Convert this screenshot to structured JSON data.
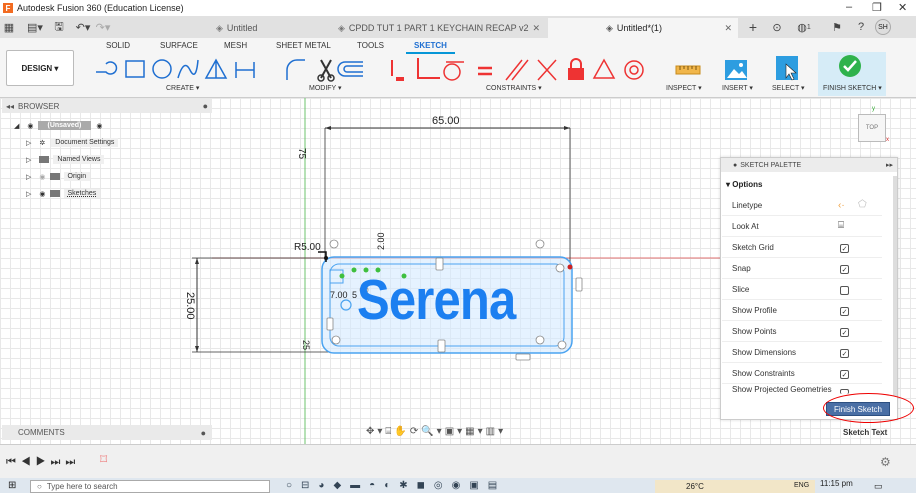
{
  "window": {
    "title": "Autodesk Fusion 360 (Education License)"
  },
  "tabs": [
    {
      "label": "Untitled"
    },
    {
      "label": "CPDD TUT 1 PART 1 KEYCHAIN RECAP v2"
    },
    {
      "label": "Untitled*(1)"
    }
  ],
  "user_initials": "SH",
  "notifications_count": "1",
  "ribbon": {
    "design_label": "DESIGN ▾",
    "tabs": [
      "SOLID",
      "SURFACE",
      "MESH",
      "SHEET METAL",
      "TOOLS",
      "SKETCH"
    ],
    "active_tab": "SKETCH",
    "groups": [
      "CREATE ▾",
      "MODIFY ▾",
      "CONSTRAINTS ▾",
      "INSPECT ▾",
      "INSERT ▾",
      "SELECT ▾",
      "FINISH SKETCH ▾"
    ]
  },
  "browser": {
    "title": "BROWSER",
    "root": "(Unsaved)",
    "items": [
      "Document Settings",
      "Named Views",
      "Origin",
      "Sketches"
    ]
  },
  "sketch": {
    "text": "Serena",
    "dim_width": "65.00",
    "dim_height": "25.00",
    "dim_radius": "R5.00",
    "dim_vertical": "75",
    "dim_small1": "2.00",
    "dim_small2": "7.00",
    "dim_small3": "25",
    "dim_small4": "5"
  },
  "viewcube_label": "TOP",
  "palette": {
    "title": "SKETCH PALETTE",
    "section": "Options",
    "options": [
      {
        "label": "Linetype",
        "kind": "icons"
      },
      {
        "label": "Look At",
        "kind": "icon"
      },
      {
        "label": "Sketch Grid",
        "kind": "check",
        "checked": true
      },
      {
        "label": "Snap",
        "kind": "check",
        "checked": true
      },
      {
        "label": "Slice",
        "kind": "check",
        "checked": false
      },
      {
        "label": "Show Profile",
        "kind": "check",
        "checked": true
      },
      {
        "label": "Show Points",
        "kind": "check",
        "checked": true
      },
      {
        "label": "Show Dimensions",
        "kind": "check",
        "checked": true
      },
      {
        "label": "Show Constraints",
        "kind": "check",
        "checked": true
      },
      {
        "label": "Show Projected Geometries",
        "kind": "check",
        "checked": true
      }
    ],
    "finish_button": "Finish Sketch",
    "footer_label": "Sketch Text"
  },
  "comments": {
    "title": "COMMENTS"
  },
  "taskbar": {
    "search_placeholder": "Type here to search",
    "temperature": "26°C",
    "language": "ENG",
    "time": "11:15 pm"
  },
  "colors": {
    "accent": "#0696d7",
    "sketch_text": "#1c7ff0",
    "profile_fill": "#cfe8ff",
    "finish_green": "#2fb24c",
    "annotation_red": "#e00000"
  }
}
